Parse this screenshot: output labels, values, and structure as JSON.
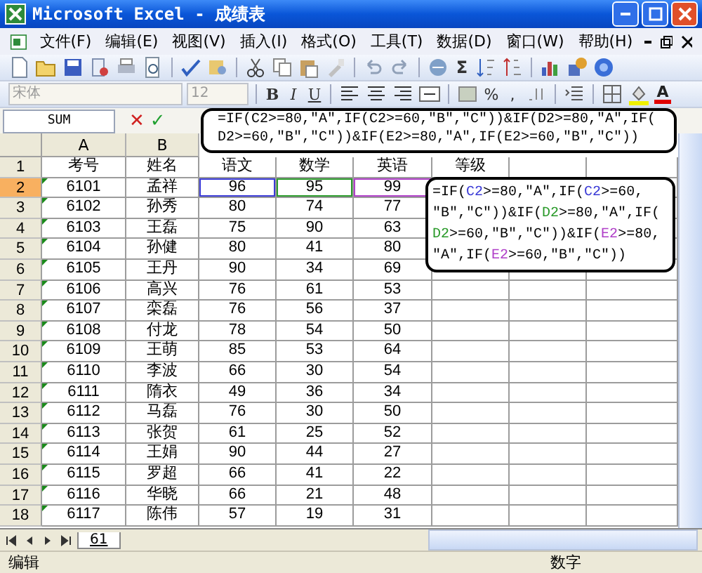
{
  "window": {
    "title": "Microsoft Excel - 成绩表"
  },
  "menu": [
    "文件(F)",
    "编辑(E)",
    "视图(V)",
    "插入(I)",
    "格式(O)",
    "工具(T)",
    "数据(D)",
    "窗口(W)",
    "帮助(H)"
  ],
  "standard_toolbar": {
    "autosum": "Σ"
  },
  "format_toolbar": {
    "font": "宋体",
    "size": "12",
    "bold": "B",
    "italic": "I",
    "underline": "U",
    "percent": "%",
    "comma": ",",
    "font_color": "A"
  },
  "formula_bar": {
    "name_box": "SUM",
    "cancel": "✕",
    "enter": "✓",
    "formula": "=IF(C2>=80,\"A\",IF(C2>=60,\"B\",\"C\"))&IF(D2>=80,\"A\",IF(D2>=60,\"B\",\"C\"))&IF(E2>=80,\"A\",IF(E2>=60,\"B\",\"C\"))"
  },
  "sheet": {
    "column_headers": [
      "A",
      "B"
    ],
    "rows": [
      {
        "number": "1",
        "selected": false,
        "text_marker": false,
        "cells": [
          "考号",
          "姓名",
          "语文",
          "数学",
          "英语",
          "等级"
        ]
      },
      {
        "number": "2",
        "selected": true,
        "text_marker": true,
        "cells": [
          "6101",
          "孟祥",
          {
            "text": "96",
            "color": "#3a3ad6"
          },
          {
            "text": "95",
            "color": "#2a9a2a"
          },
          {
            "text": "99",
            "color": "#b040c8"
          }
        ]
      },
      {
        "number": "3",
        "selected": false,
        "text_marker": true,
        "cells": [
          "6102",
          "孙秀",
          "80",
          "74",
          "77"
        ]
      },
      {
        "number": "4",
        "selected": false,
        "text_marker": true,
        "cells": [
          "6103",
          "王磊",
          "75",
          "90",
          "63"
        ]
      },
      {
        "number": "5",
        "selected": false,
        "text_marker": true,
        "cells": [
          "6104",
          "孙健",
          "80",
          "41",
          "80"
        ]
      },
      {
        "number": "6",
        "selected": false,
        "text_marker": true,
        "cells": [
          "6105",
          "王丹",
          "90",
          "34",
          "69"
        ]
      },
      {
        "number": "7",
        "selected": false,
        "text_marker": true,
        "cells": [
          "6106",
          "高兴",
          "76",
          "61",
          "53"
        ]
      },
      {
        "number": "8",
        "selected": false,
        "text_marker": true,
        "cells": [
          "6107",
          "栾磊",
          "76",
          "56",
          "37"
        ]
      },
      {
        "number": "9",
        "selected": false,
        "text_marker": true,
        "cells": [
          "6108",
          "付龙",
          "78",
          "54",
          "50"
        ]
      },
      {
        "number": "10",
        "selected": false,
        "text_marker": true,
        "cells": [
          "6109",
          "王萌",
          "85",
          "53",
          "64"
        ]
      },
      {
        "number": "11",
        "selected": false,
        "text_marker": true,
        "cells": [
          "6110",
          "李波",
          "66",
          "30",
          "54"
        ]
      },
      {
        "number": "12",
        "selected": false,
        "text_marker": true,
        "cells": [
          "6111",
          "隋衣",
          "49",
          "36",
          "34"
        ]
      },
      {
        "number": "13",
        "selected": false,
        "text_marker": true,
        "cells": [
          "6112",
          "马磊",
          "76",
          "30",
          "50"
        ]
      },
      {
        "number": "14",
        "selected": false,
        "text_marker": true,
        "cells": [
          "6113",
          "张贺",
          "61",
          "25",
          "52"
        ]
      },
      {
        "number": "15",
        "selected": false,
        "text_marker": true,
        "cells": [
          "6114",
          "王娟",
          "90",
          "44",
          "27"
        ]
      },
      {
        "number": "16",
        "selected": false,
        "text_marker": true,
        "cells": [
          "6115",
          "罗超",
          "66",
          "41",
          "22"
        ]
      },
      {
        "number": "17",
        "selected": false,
        "text_marker": true,
        "cells": [
          "6116",
          "华晓",
          "66",
          "21",
          "48"
        ]
      },
      {
        "number": "18",
        "selected": false,
        "text_marker": true,
        "cells": [
          "6117",
          "陈伟",
          "57",
          "19",
          "31"
        ]
      }
    ],
    "cell_editor": {
      "lines": [
        [
          {
            "text": "=IF(",
            "color": "#000000"
          },
          {
            "text": "C2",
            "color": "#3a3ad6"
          },
          {
            "text": ">=80,\"A\",IF(",
            "color": "#000000"
          },
          {
            "text": "C2",
            "color": "#3a3ad6"
          },
          {
            "text": ">=60,",
            "color": "#000000"
          }
        ],
        [
          {
            "text": "\"B\",\"C\"))&IF(",
            "color": "#000000"
          },
          {
            "text": "D2",
            "color": "#2a9a2a"
          },
          {
            "text": ">=80,\"A\",IF(",
            "color": "#000000"
          }
        ],
        [
          {
            "text": "D2",
            "color": "#2a9a2a"
          },
          {
            "text": ">=60,\"B\",\"C\"))&IF(",
            "color": "#000000"
          },
          {
            "text": "E2",
            "color": "#b040c8"
          },
          {
            "text": ">=80,",
            "color": "#000000"
          }
        ],
        [
          {
            "text": "\"A\",IF(",
            "color": "#000000"
          },
          {
            "text": "E2",
            "color": "#b040c8"
          },
          {
            "text": ">=60,\"B\",\"C\"))",
            "color": "#000000"
          }
        ]
      ]
    }
  },
  "sheet_tabs": [
    {
      "label": "61",
      "selected": true
    }
  ],
  "status_bar": {
    "mode": "编辑",
    "indicator": "数字"
  }
}
